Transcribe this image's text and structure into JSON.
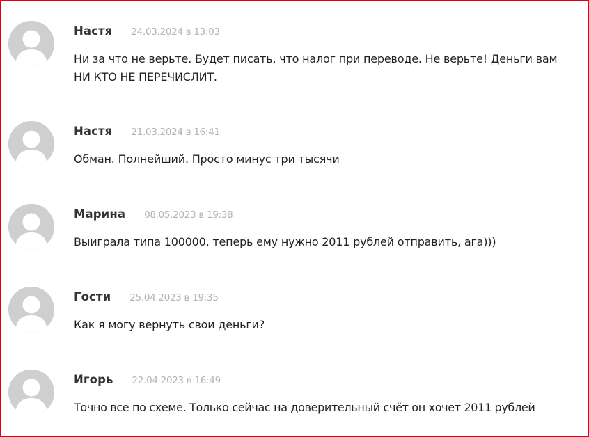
{
  "comments": [
    {
      "author": "Настя",
      "date": "24.03.2024 в 13:03",
      "text": "Ни за что не верьте. Будет писать, что налог при переводе. Не верьте! Деньги вам НИ КТО НЕ ПЕРЕЧИСЛИТ.",
      "avatar_icon": "default-user-avatar-icon"
    },
    {
      "author": "Настя",
      "date": "21.03.2024 в 16:41",
      "text": "Обман. Полнейший. Просто минус три тысячи",
      "avatar_icon": "default-user-avatar-icon"
    },
    {
      "author": "Марина",
      "date": "08.05.2023 в 19:38",
      "text": "Выиграла типа 100000, теперь ему нужно 2011 рублей отправить, ага)))",
      "avatar_icon": "default-user-avatar-icon"
    },
    {
      "author": "Гости",
      "date": "25.04.2023 в 19:35",
      "text": "Как я могу вернуть свои деньги?",
      "avatar_icon": "default-user-avatar-icon"
    },
    {
      "author": "Игорь",
      "date": "22.04.2023 в 16:49",
      "text": "Точно все по схеме. Только сейчас на доверительный счёт он хочет 2011 рублей",
      "avatar_icon": "default-user-avatar-icon"
    }
  ],
  "colors": {
    "frame_border": "#e3000f",
    "avatar_bg": "#cfcfcf",
    "avatar_fg": "#ffffff",
    "author": "#333333",
    "date": "#b3b3b3",
    "text": "#222222"
  }
}
